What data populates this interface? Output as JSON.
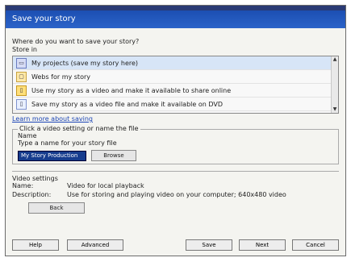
{
  "window": {
    "title": "Save your story"
  },
  "dialog": {
    "prompt": "Where do you want to save your story?",
    "locations_label": "Store in",
    "locations": [
      {
        "label": "My projects (save my story here)",
        "selected": true,
        "icon": "computer-icon"
      },
      {
        "label": "Webs for my story",
        "selected": false,
        "icon": "folder-icon"
      },
      {
        "label": "Use my story as a video and make it available to share online",
        "selected": false,
        "icon": "page-icon"
      },
      {
        "label": "Save my story as a video file and make it available on DVD",
        "selected": false,
        "icon": "page-icon"
      }
    ],
    "link": "Learn more about saving"
  },
  "file_section": {
    "header": "Click a video setting or name the file",
    "name_label": "Name",
    "description": "Type a name for your story file",
    "input_value": "My Story Production",
    "browse_label": "Browse"
  },
  "details": {
    "header": "Video settings",
    "rows": [
      {
        "label": "Name:",
        "value": "Video for local playback"
      },
      {
        "label": "Description:",
        "value": "Use for storing and playing video on your computer; 640x480 video"
      }
    ],
    "back_label": "Back"
  },
  "buttons": {
    "help": "Help",
    "advanced": "Advanced",
    "save": "Save",
    "next": "Next",
    "cancel": "Cancel"
  }
}
